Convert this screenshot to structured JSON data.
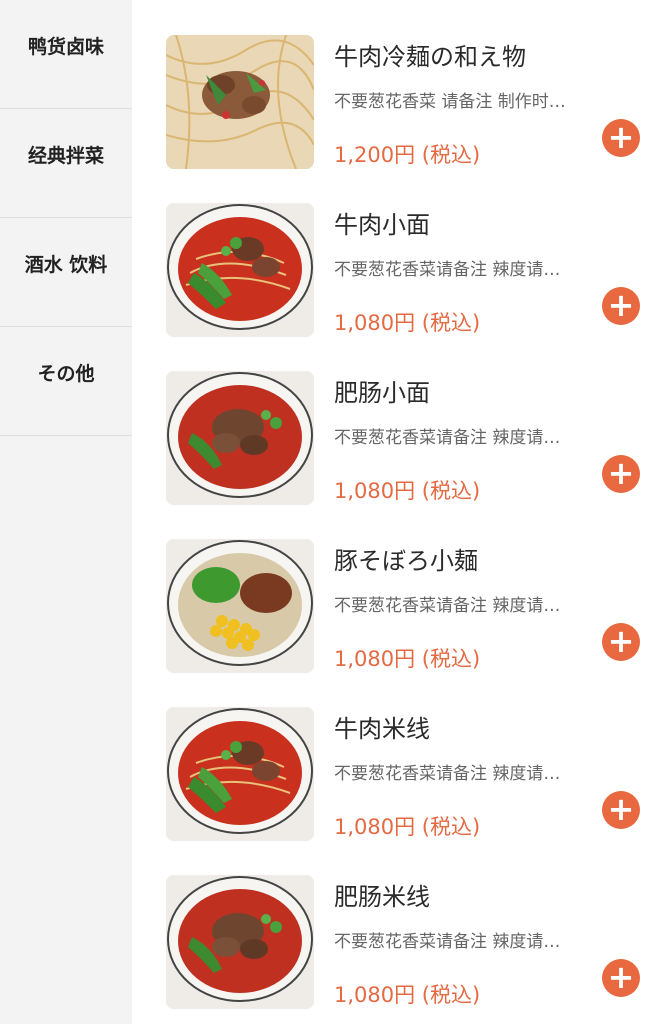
{
  "sidebar": {
    "categories": [
      "鸭货卤味",
      "经典拌菜",
      "酒水 饮料",
      "その他"
    ]
  },
  "items": [
    {
      "name": "牛肉冷麺の和え物",
      "desc": "不要葱花香菜 请备注 制作时…",
      "price": "1,200円 (税込)",
      "thumb_type": "cold-noodles"
    },
    {
      "name": "牛肉小面",
      "desc": "不要葱花香菜请备注 辣度请…",
      "price": "1,080円 (税込)",
      "thumb_type": "beef-bowl"
    },
    {
      "name": "肥肠小面",
      "desc": "不要葱花香菜请备注 辣度请…",
      "price": "1,080円 (税込)",
      "thumb_type": "intestine-bowl"
    },
    {
      "name": "豚そぼろ小麺",
      "desc": "不要葱花香菜请备注 辣度请…",
      "price": "1,080円 (税込)",
      "thumb_type": "pork-bowl"
    },
    {
      "name": "牛肉米线",
      "desc": "不要葱花香菜请备注 辣度请…",
      "price": "1,080円 (税込)",
      "thumb_type": "beef-bowl"
    },
    {
      "name": "肥肠米线",
      "desc": "不要葱花香菜请备注 辣度请…",
      "price": "1,080円 (税込)",
      "thumb_type": "intestine-bowl"
    }
  ],
  "add_icon_glyph": "+",
  "colors": {
    "price": "#e46a43",
    "add_button": "#e8683f",
    "sidebar_bg": "#f3f3f3"
  }
}
